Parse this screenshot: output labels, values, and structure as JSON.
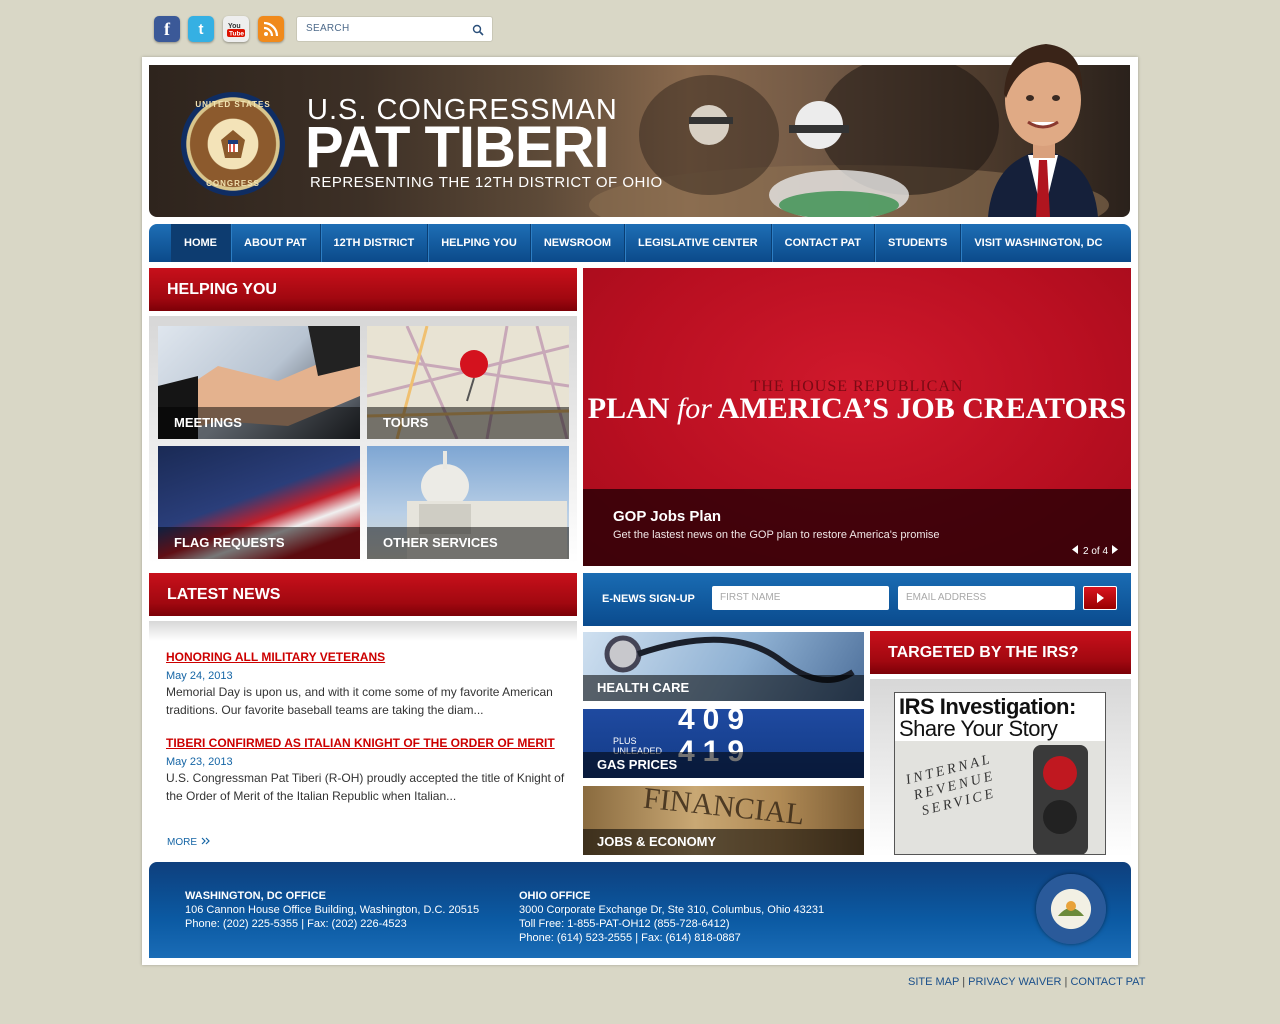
{
  "social": {
    "facebook": "facebook-icon",
    "twitter": "twitter-icon",
    "youtube": "youtube-icon",
    "rss": "rss-icon"
  },
  "search": {
    "placeholder": "SEARCH"
  },
  "banner": {
    "line1": "U.S. CONGRESSMAN",
    "line2": "PAT TIBERI",
    "line3": "REPRESENTING THE 12TH DISTRICT OF OHIO",
    "seal_top": "UNITED STATES",
    "seal_bottom": "CONGRESS"
  },
  "nav": [
    "HOME",
    "ABOUT PAT",
    "12TH DISTRICT",
    "HELPING YOU",
    "NEWSROOM",
    "LEGISLATIVE CENTER",
    "CONTACT PAT",
    "STUDENTS",
    "VISIT WASHINGTON, DC"
  ],
  "helping": {
    "title": "HELPING YOU",
    "tiles": [
      "MEETINGS",
      "TOURS",
      "FLAG REQUESTS",
      "OTHER SERVICES"
    ]
  },
  "slide": {
    "kicker": "THE HOUSE REPUBLICAN",
    "plan_a": "PLAN ",
    "plan_b": "for",
    "plan_c": " AMERICA’S JOB CREATORS",
    "title": "GOP Jobs Plan",
    "desc": "Get the lastest news on the GOP plan to restore America's promise",
    "counter": "2 of 4"
  },
  "news": {
    "title": "LATEST NEWS",
    "items": [
      {
        "title": "HONORING ALL MILITARY VETERANS",
        "date": "May 24, 2013",
        "body": "Memorial Day is upon us, and with it come some of my favorite American traditions. Our favorite baseball teams are taking the diam..."
      },
      {
        "title": "TIBERI CONFIRMED AS ITALIAN KNIGHT OF THE ORDER OF MERIT",
        "date": "May 23, 2013",
        "body": "U.S. Congressman Pat Tiberi (R-OH) proudly accepted the title of Knight of the Order of Merit of the Italian Republic when Italian..."
      }
    ],
    "more": "MORE"
  },
  "enews": {
    "label": "E-NEWS SIGN-UP",
    "first_name": "FIRST NAME",
    "email": "EMAIL ADDRESS"
  },
  "issues": [
    "HEALTH CARE",
    "GAS PRICES",
    "JOBS & ECONOMY"
  ],
  "issue_art": {
    "gas_top": "409",
    "gas_bottom": "419",
    "gas_label1": "PLUS",
    "gas_label2": "UNLEADED",
    "financial": "FINANCIAL"
  },
  "irs": {
    "title": "TARGETED BY THE IRS?",
    "line1": "IRS Investigation:",
    "line2": "Share Your Story",
    "sign": [
      "INTERNAL",
      "REVENUE",
      "SERVICE"
    ]
  },
  "footer": {
    "dc_title": "WASHINGTON, DC OFFICE",
    "dc_addr": "106 Cannon House Office Building, Washington, D.C. 20515",
    "dc_phone": "Phone: (202) 225-5355 | Fax: (202) 226-4523",
    "oh_title": "OHIO OFFICE",
    "oh_addr": "3000 Corporate Exchange Dr, Ste 310, Columbus, Ohio 43231",
    "oh_toll": "Toll Free: 1-855-PAT-OH12 (855-728-6412)",
    "oh_phone": "Phone: (614) 523-2555 | Fax: (614) 818-0887"
  },
  "links": [
    "SITE MAP",
    "PRIVACY WAIVER",
    "CONTACT PAT"
  ]
}
